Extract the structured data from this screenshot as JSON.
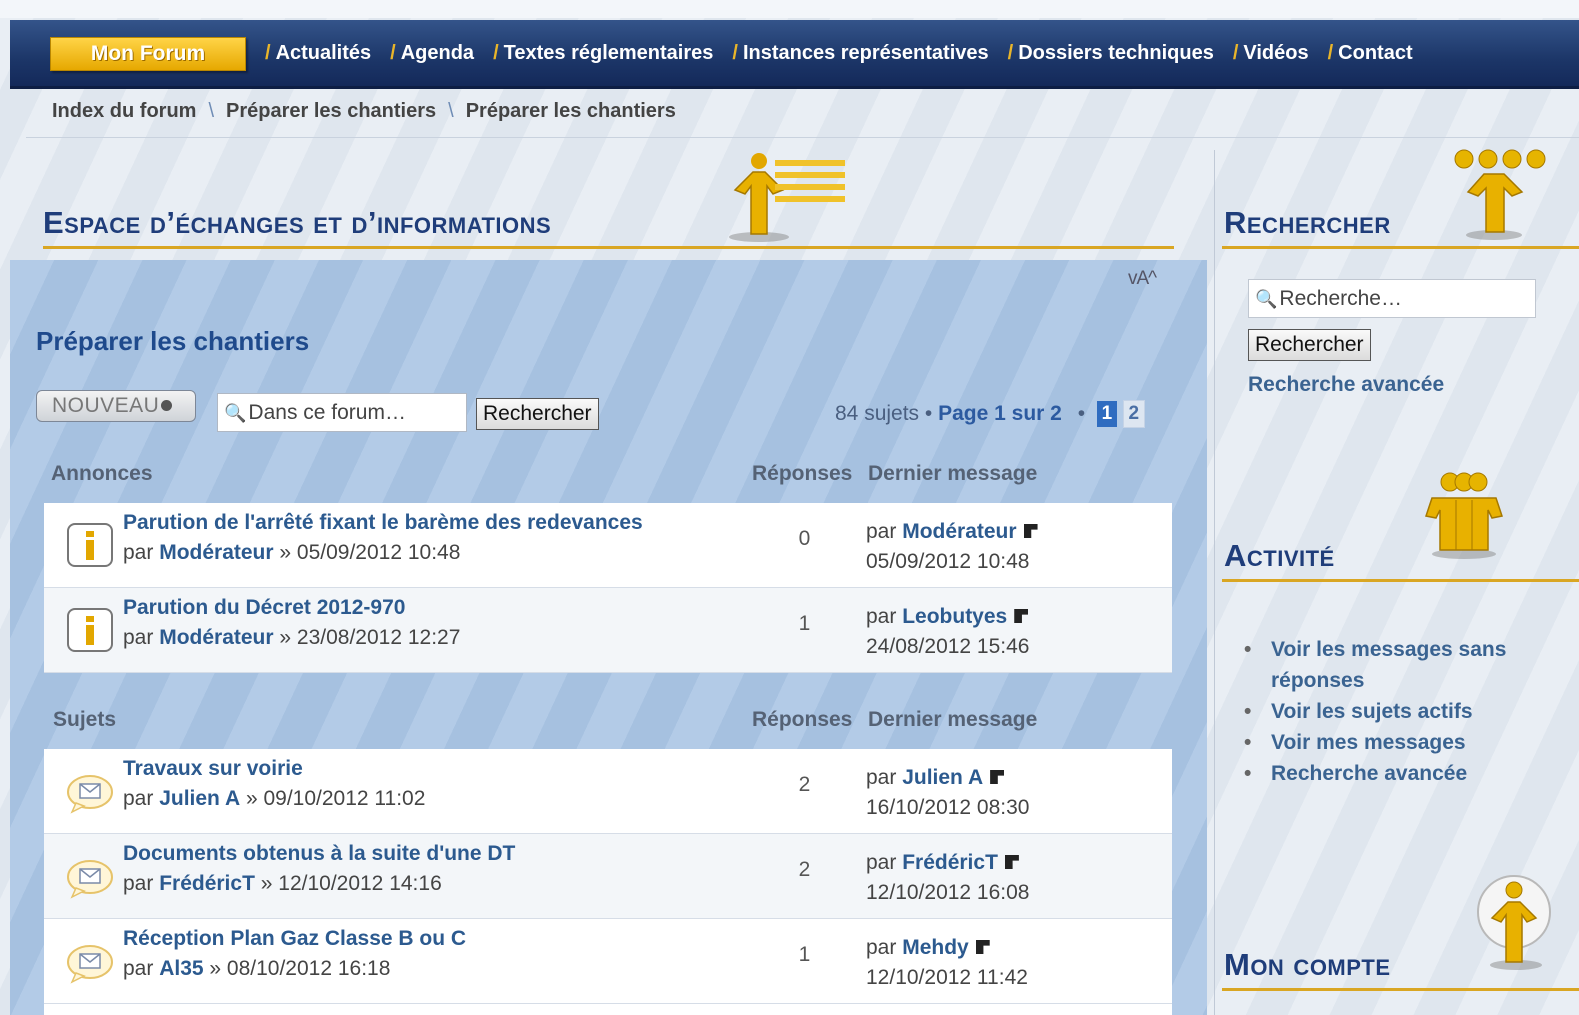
{
  "nav": {
    "home": "Mon Forum",
    "items": [
      "Actualités",
      "Agenda",
      "Textes réglementaires",
      "Instances représentatives",
      "Dossiers techniques",
      "Vidéos",
      "Contact"
    ],
    "separator": "/"
  },
  "breadcrumb": {
    "items": [
      "Index du forum",
      "Préparer les chantiers",
      "Préparer les chantiers"
    ],
    "separator": "\\"
  },
  "main": {
    "title": "Espace d’échanges et d’informations",
    "font_size_control": "vA^",
    "forum_title": "Préparer les chantiers",
    "new_button": "NOUVEAU",
    "search_placeholder": "Dans ce forum…",
    "search_button": "Rechercher",
    "pagination": {
      "count": "84 sujets",
      "dot": "•",
      "page_label": "Page 1 sur 2",
      "current": "1",
      "next": "2"
    }
  },
  "announcements": {
    "header": "Annonces",
    "replies_header": "Réponses",
    "last_header": "Dernier message",
    "rows": [
      {
        "title": "Parution de l'arrêté fixant le barème des redevances",
        "by": "par",
        "author": "Modérateur",
        "date": "» 05/09/2012 10:48",
        "replies": "0",
        "last_by": "par",
        "last_author": "Modérateur",
        "last_date": "05/09/2012 10:48"
      },
      {
        "title": "Parution du Décret 2012-970",
        "by": "par",
        "author": "Modérateur",
        "date": "» 23/08/2012 12:27",
        "replies": "1",
        "last_by": "par",
        "last_author": "Leobutyes",
        "last_date": "24/08/2012 15:46"
      }
    ]
  },
  "topics": {
    "header": "Sujets",
    "replies_header": "Réponses",
    "last_header": "Dernier message",
    "rows": [
      {
        "title": "Travaux sur voirie",
        "by": "par",
        "author": "Julien A",
        "date": "» 09/10/2012 11:02",
        "replies": "2",
        "last_by": "par",
        "last_author": "Julien A",
        "last_date": "16/10/2012 08:30"
      },
      {
        "title": "Documents obtenus à la suite d'une DT",
        "by": "par",
        "author": "FrédéricT",
        "date": "» 12/10/2012 14:16",
        "replies": "2",
        "last_by": "par",
        "last_author": "FrédéricT",
        "last_date": "12/10/2012 16:08"
      },
      {
        "title": "Réception Plan Gaz Classe B ou C",
        "by": "par",
        "author": "Al35",
        "date": "» 08/10/2012 16:18",
        "replies": "1",
        "last_by": "par",
        "last_author": "Mehdy",
        "last_date": "12/10/2012 11:42"
      }
    ]
  },
  "sidebar": {
    "search_title": "Rechercher",
    "search_placeholder": "Recherche…",
    "search_button": "Rechercher",
    "advanced_link": "Recherche avancée",
    "activity_title": "Activité",
    "activity_items": [
      "Voir les messages sans réponses",
      "Voir les sujets actifs",
      "Voir mes messages",
      "Recherche avancée"
    ],
    "account_title": "Mon compte"
  },
  "colors": {
    "nav_bg": "#1c3668",
    "accent_gold": "#d9a623",
    "title_blue": "#1f3d7a",
    "link_blue": "#2c5a8f"
  },
  "icons": {
    "announcement": "info-icon",
    "topic": "speech-bubble-icon",
    "last_post": "goto-post-icon",
    "search": "magnifier-icon"
  }
}
